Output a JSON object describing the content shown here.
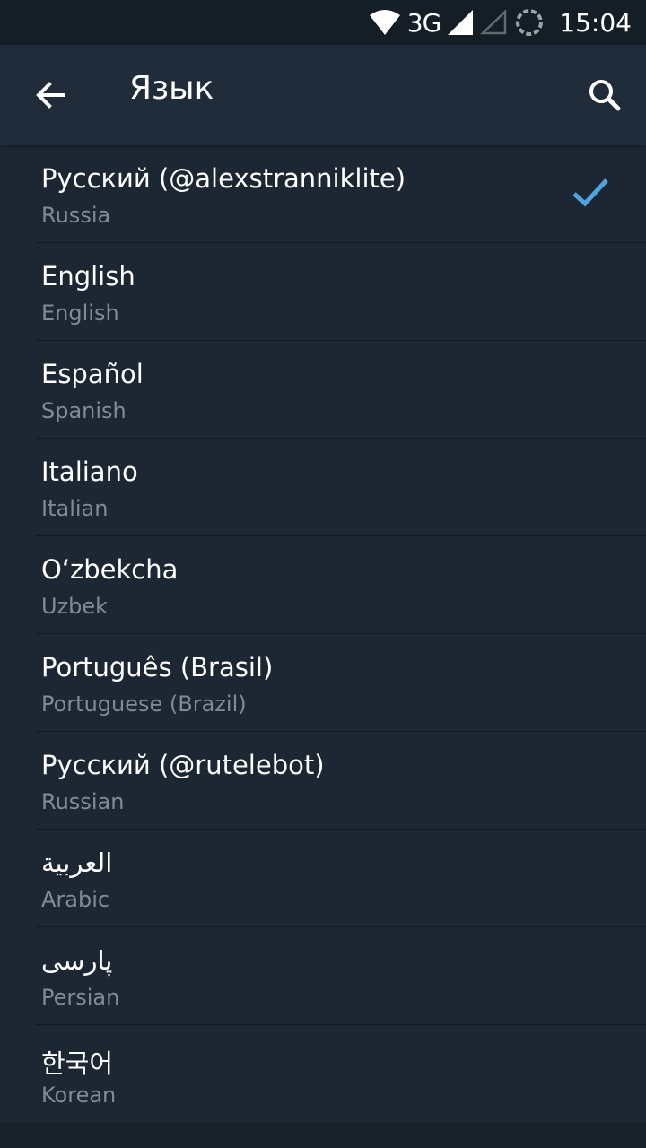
{
  "status_bar": {
    "network": "3G",
    "time": "15:04",
    "icons": [
      "wifi-icon",
      "signal-icon",
      "signal-empty-icon",
      "sync-icon"
    ]
  },
  "app_bar": {
    "title": "Язык",
    "back_icon": "arrow-left-icon",
    "search_icon": "search-icon"
  },
  "accent_color": "#4fa3e0",
  "languages": [
    {
      "name": "Русский (@alexstranniklite)",
      "subtitle": "Russia",
      "selected": true
    },
    {
      "name": "English",
      "subtitle": "English",
      "selected": false
    },
    {
      "name": "Español",
      "subtitle": "Spanish",
      "selected": false
    },
    {
      "name": "Italiano",
      "subtitle": "Italian",
      "selected": false
    },
    {
      "name": "Oʻzbekcha",
      "subtitle": "Uzbek",
      "selected": false
    },
    {
      "name": "Português (Brasil)",
      "subtitle": "Portuguese (Brazil)",
      "selected": false
    },
    {
      "name": "Русский (@rutelebot)",
      "subtitle": "Russian",
      "selected": false
    },
    {
      "name": "العربية",
      "subtitle": "Arabic",
      "selected": false
    },
    {
      "name": "پارسی",
      "subtitle": "Persian",
      "selected": false
    },
    {
      "name": "한국어",
      "subtitle": "Korean",
      "selected": false
    }
  ]
}
